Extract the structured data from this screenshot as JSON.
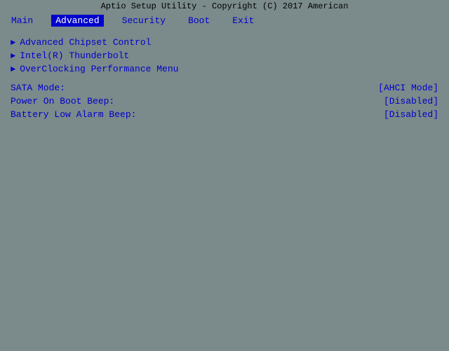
{
  "title_bar": {
    "text": "Aptio Setup Utility - Copyright (C) 2017 American"
  },
  "menu_bar": {
    "items": [
      {
        "label": "Main",
        "active": false
      },
      {
        "label": "Advanced",
        "active": true
      },
      {
        "label": "Security",
        "active": false
      },
      {
        "label": "Boot",
        "active": false
      },
      {
        "label": "Exit",
        "active": false
      }
    ]
  },
  "content": {
    "submenu_items": [
      {
        "label": "Advanced Chipset Control"
      },
      {
        "label": "Intel(R) Thunderbolt"
      },
      {
        "label": "OverClocking Performance Menu"
      }
    ],
    "settings": [
      {
        "label": "SATA Mode:",
        "value": "[AHCI Mode]"
      },
      {
        "label": "Power On Boot Beep:",
        "value": "[Disabled]"
      },
      {
        "label": "Battery Low Alarm Beep:",
        "value": "[Disabled]"
      }
    ]
  }
}
